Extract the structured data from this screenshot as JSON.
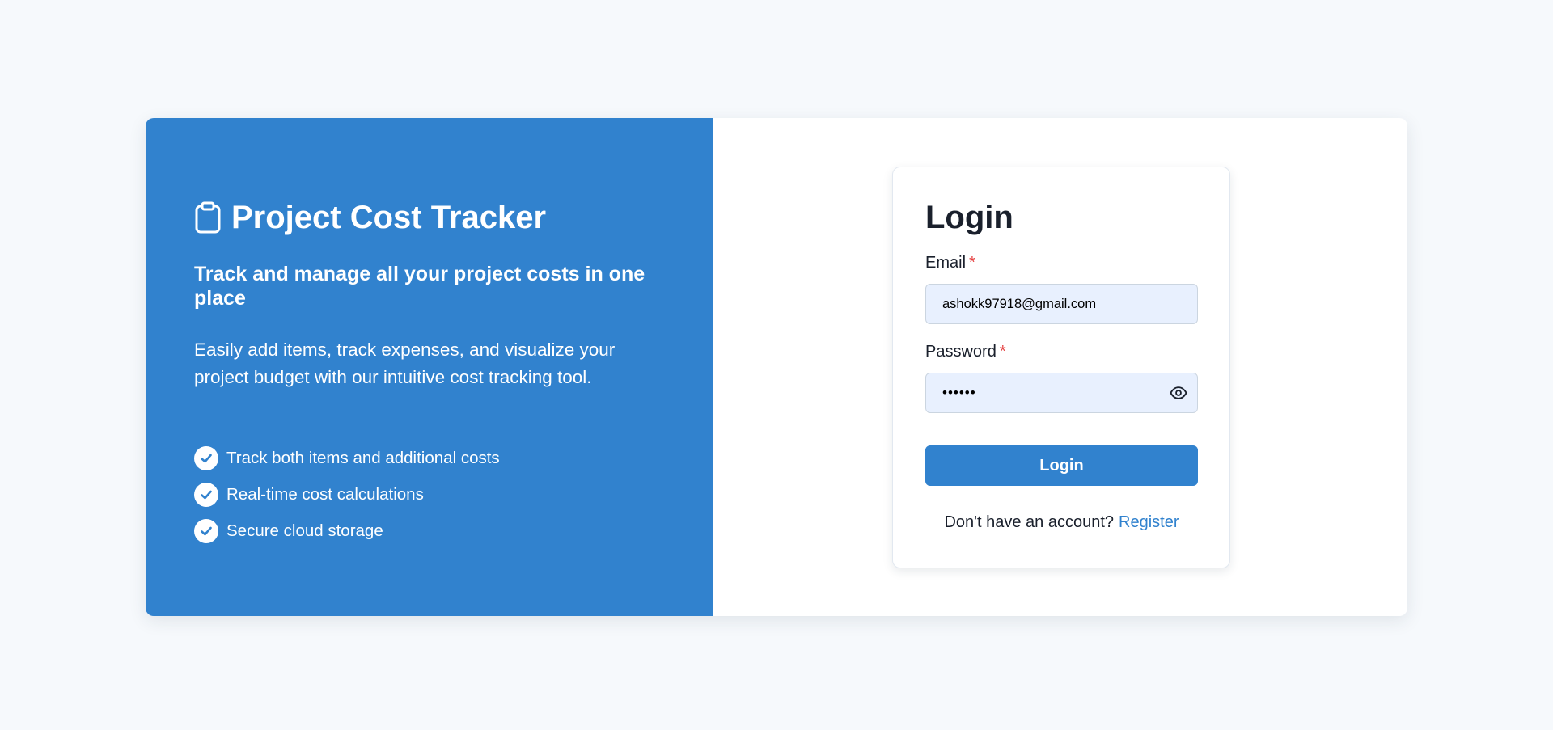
{
  "hero": {
    "app_icon": "clipboard-icon",
    "app_name": "Project Cost Tracker",
    "tagline": "Track and manage all your project costs in one place",
    "description": "Easily add items, track expenses, and visualize your project budget with our intuitive cost tracking tool.",
    "features": [
      {
        "icon": "check-circle-icon",
        "label": "Track both items and additional costs"
      },
      {
        "icon": "check-circle-icon",
        "label": "Real-time cost calculations"
      },
      {
        "icon": "check-circle-icon",
        "label": "Secure cloud storage"
      }
    ]
  },
  "login": {
    "title": "Login",
    "email_label": "Email",
    "email_value": "ashokk97918@gmail.com",
    "password_label": "Password",
    "password_value": "••••••",
    "required_marker": "*",
    "show_password_icon": "eye-icon",
    "submit_label": "Login",
    "register_prompt": "Don't have an account?",
    "register_link": "Register"
  },
  "colors": {
    "page_background": "#f6f9fc",
    "brand_blue": "#3182ce",
    "input_background": "#e8f0fe",
    "required_red": "#e53e3e",
    "text_dark": "#1a202c"
  }
}
